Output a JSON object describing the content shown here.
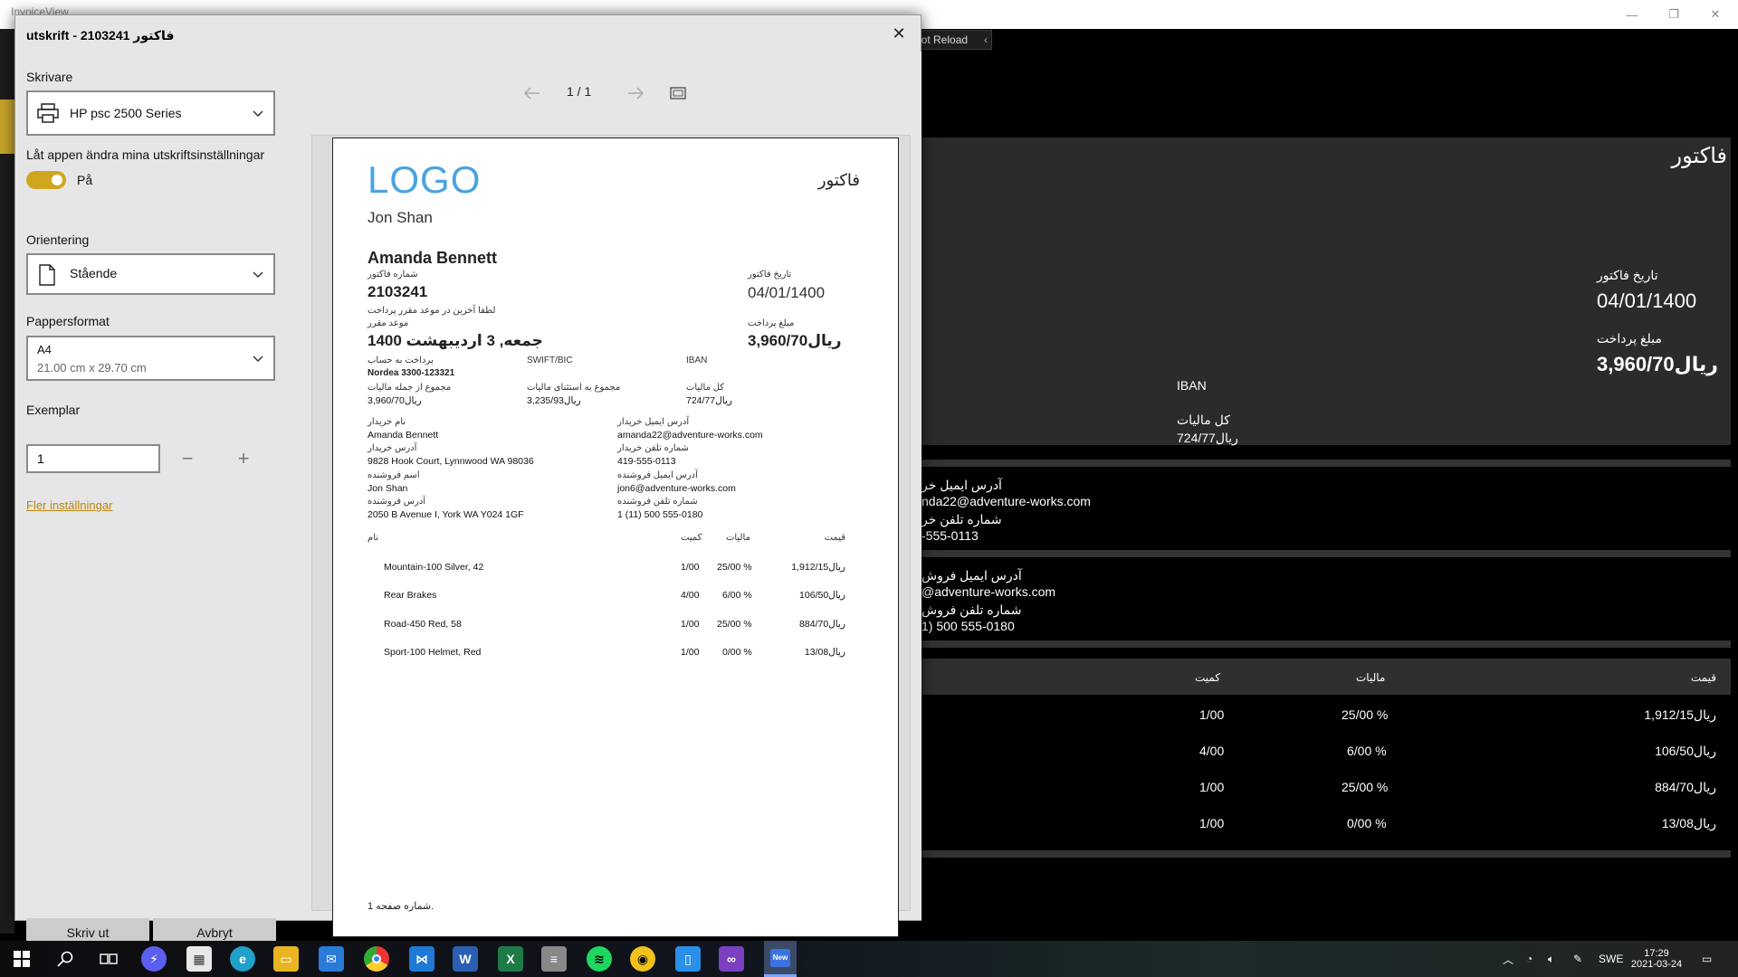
{
  "background_app": {
    "title": "InvoiceView",
    "hot_reload_label": "lot Reload",
    "invoice_heading": "فاکتور",
    "invoice_date_label": "تاریخ فاکتور",
    "invoice_date_value": "04/01/1400",
    "amount_label": "مبلغ پرداخت",
    "amount_value": "3,960/70ریال",
    "iban_label": "IBAN",
    "total_tax_label": "کل مالیات",
    "total_tax_value": "724/77ریال",
    "buyer_email_label": "آدرس ایمیل خر",
    "buyer_email_value": "nda22@adventure-works.com",
    "buyer_phone_label": "شماره تلفن خر",
    "buyer_phone_value": "-555-0113",
    "seller_email_label": "آدرس ایمیل فروش",
    "seller_email_value": "@adventure-works.com",
    "seller_phone_label": "شماره تلفن فروش",
    "seller_phone_value": "1) 500 555-0180",
    "table_headers": {
      "qty": "کمیت",
      "tax": "مالیات",
      "price": "قیمت"
    },
    "rows": [
      {
        "qty": "1/00",
        "tax": "25/00 %",
        "price": "1,912/15ریال"
      },
      {
        "qty": "4/00",
        "tax": "6/00 %",
        "price": "106/50ریال"
      },
      {
        "qty": "1/00",
        "tax": "25/00 %",
        "price": "884/70ریال"
      },
      {
        "qty": "1/00",
        "tax": "0/00 %",
        "price": "13/08ریال"
      }
    ]
  },
  "print_dialog": {
    "title": "utskrift - 2103241 فاکتور",
    "printer_label": "Skrivare",
    "printer_value": "HP psc 2500 Series",
    "app_settings_label": "Låt appen ändra mina utskriftsinställningar",
    "toggle_state": "På",
    "orientation_label": "Orientering",
    "orientation_value": "Stående",
    "paper_label": "Pappersformat",
    "paper_value": "A4",
    "paper_size": "21.00 cm x 29.70 cm",
    "copies_label": "Exemplar",
    "copies_value": "1",
    "more_settings": "Fler inställningar",
    "print_button": "Skriv ut",
    "cancel_button": "Avbryt",
    "page_indicator": "1 / 1",
    "accent_color": "#d1a61f"
  },
  "preview_page": {
    "logo": "LOGO",
    "seller_name_top": "Jon Shan",
    "heading": "فاکتور",
    "customer_name": "Amanda Bennett",
    "invoice_number_label": "شماره فاکتور",
    "invoice_number": "2103241",
    "invoice_date_label": "تاریخ فاکتور",
    "invoice_date": "04/01/1400",
    "pay_note": "لطفا آخرین در موعد مقرر پرداخت",
    "due_label": "موعد مقرر",
    "due_date": "جمعه, 3 اردیبهشت 1400",
    "amount_label": "مبلغ پرداخت",
    "amount": "3,960/70ریال",
    "pay_to_label": "پرداخت به حساب",
    "swift_label": "SWIFT/BIC",
    "iban_label": "IBAN",
    "account": "Nordea 3300-123321",
    "subtotal_label": "مجموع از جمله مالیات",
    "subtotal": "3,960/70ریال",
    "excl_tax_label": "مجموع به استثنای مالیات",
    "excl_tax": "3,235/93ریال",
    "total_tax_label": "کل مالیات",
    "total_tax": "724/77ریال",
    "buyer_name_label": "نام خریدار",
    "buyer_name": "Amanda Bennett",
    "buyer_address_label": "آدرس خریدار",
    "buyer_address": "9828 Hook Court, Lynnwood WA 98036",
    "seller_name_label": "اسم فروشنده",
    "seller_name": "Jon Shan",
    "seller_address_label": "آدرس فروشنده",
    "seller_address": "2050 B Avenue I, York WA Y024 1GF",
    "buyer_email_label": "آدرس ایمیل خریدار",
    "buyer_email": "amanda22@adventure-works.com",
    "buyer_phone_label": "شماره تلفن خریدار",
    "buyer_phone": "419-555-0113",
    "seller_email_label": "آدرس ایمیل فروشنده",
    "seller_email": "jon6@adventure-works.com",
    "seller_phone_label": "شماره تلفن فروشنده",
    "seller_phone": "1 (11) 500 555-0180",
    "table_headers": {
      "name": "نام",
      "qty": "کمیت",
      "tax": "مالیات",
      "price": "قیمت"
    },
    "items": [
      {
        "name": "Mountain-100 Silver, 42",
        "qty": "1/00",
        "tax": "25/00 %",
        "price": "1,912/15ریال"
      },
      {
        "name": "Rear Brakes",
        "qty": "4/00",
        "tax": "6/00 %",
        "price": "106/50ریال"
      },
      {
        "name": "Road-450 Red, 58",
        "qty": "1/00",
        "tax": "25/00 %",
        "price": "884/70ریال"
      },
      {
        "name": "Sport-100 Helmet, Red",
        "qty": "1/00",
        "tax": "0/00 %",
        "price": "13/08ریال"
      }
    ],
    "footer": "شماره صفحه 1."
  },
  "taskbar": {
    "language": "SWE",
    "time": "17:29",
    "date": "2021-03-24",
    "icons": [
      "windows-start-icon",
      "search-icon",
      "task-view-icon",
      "messenger-icon",
      "store-icon",
      "edge-icon",
      "file-explorer-icon",
      "mail-icon",
      "chrome-icon",
      "vscode-icon",
      "word-icon",
      "excel-icon",
      "database-icon",
      "spotify-icon",
      "app-icon",
      "device-icon",
      "visual-studio-icon",
      "invoice-app-icon"
    ]
  }
}
